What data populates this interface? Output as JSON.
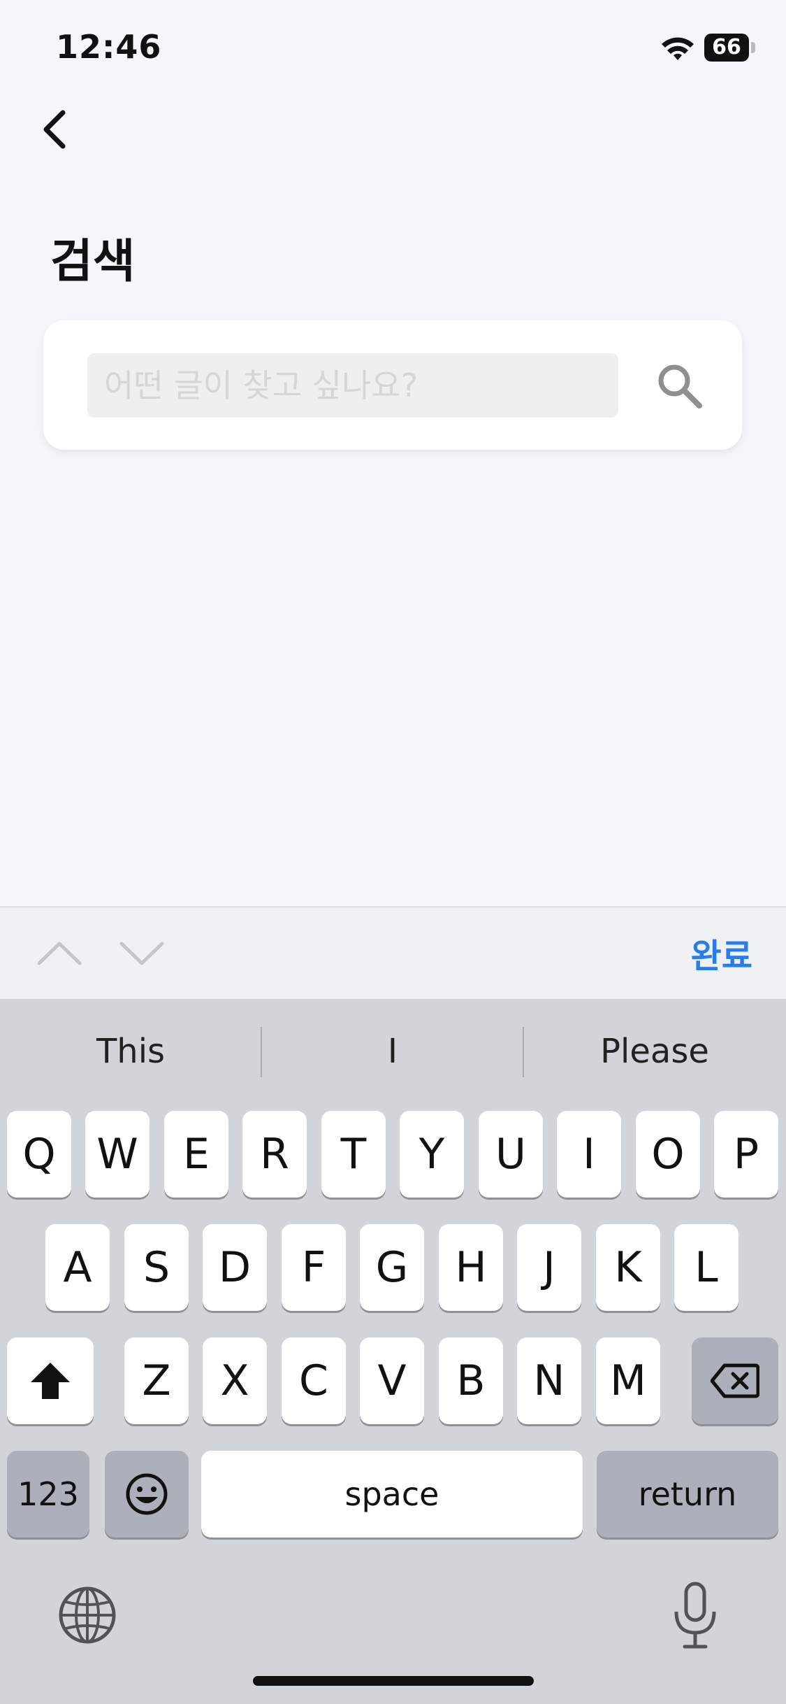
{
  "status_bar": {
    "time": "12:46",
    "battery": "66"
  },
  "header": {
    "title": "검색"
  },
  "search": {
    "placeholder": "어떤 글이 찾고 싶나요?",
    "value": ""
  },
  "accessory": {
    "done_label": "완료"
  },
  "keyboard": {
    "suggestions": [
      "This",
      "I",
      "Please"
    ],
    "row1": [
      "Q",
      "W",
      "E",
      "R",
      "T",
      "Y",
      "U",
      "I",
      "O",
      "P"
    ],
    "row2": [
      "A",
      "S",
      "D",
      "F",
      "G",
      "H",
      "J",
      "K",
      "L"
    ],
    "row3": [
      "Z",
      "X",
      "C",
      "V",
      "B",
      "N",
      "M"
    ],
    "numbers_label": "123",
    "space_label": "space",
    "return_label": "return"
  }
}
